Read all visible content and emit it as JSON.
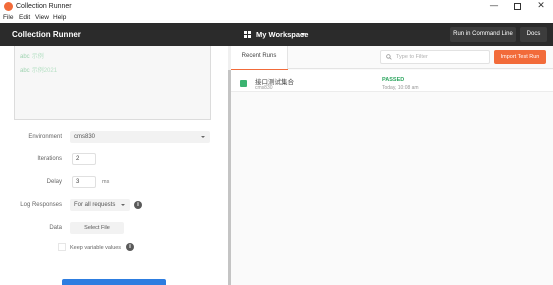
{
  "window": {
    "title": "Collection Runner",
    "minimize_glyph": "—",
    "close_glyph": "✕"
  },
  "menu": [
    "File",
    "Edit",
    "View",
    "Help"
  ],
  "header": {
    "title": "Collection Runner",
    "workspace_label": "My Workspace",
    "workspace_icon": "grid-icon",
    "run_in_cli_label": "Run in Command Line",
    "docs_label": "Docs"
  },
  "collections": {
    "items": [
      {
        "badge": "abc",
        "label": "示例"
      },
      {
        "badge": "abc",
        "label": "示例2021"
      }
    ]
  },
  "form": {
    "environment_label": "Environment",
    "environment_value": "cms830",
    "iterations_label": "Iterations",
    "iterations_value": "2",
    "delay_label": "Delay",
    "delay_value": "3",
    "delay_unit": "ms",
    "log_label": "Log Responses",
    "log_value": "For all requests",
    "data_label": "Data",
    "select_file_label": "Select File",
    "keep_values_label": "Keep variable values",
    "info_glyph": "i"
  },
  "runs": {
    "tab_label": "Recent Runs",
    "filter_placeholder": "Type to Filter",
    "import_label": "Import Test Run",
    "items": [
      {
        "name": "接口测试集合",
        "environment": "cms830",
        "status": "PASSED",
        "time": "Today, 10:08 am",
        "status_color": "#3cb371"
      }
    ]
  },
  "colors": {
    "accent": "#f26b3a",
    "header_bg": "#2b2b2b",
    "passed": "#2fa660",
    "primary_button": "#2d7de0"
  }
}
